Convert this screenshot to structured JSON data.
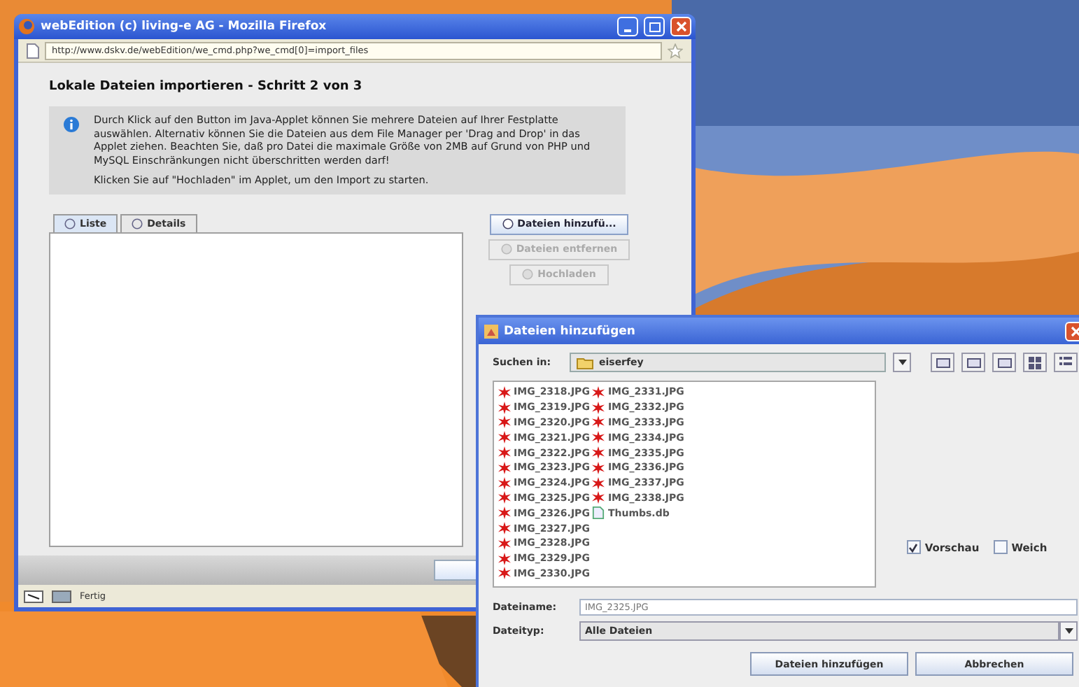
{
  "browser": {
    "title": "webEdition (c) living-e AG - Mozilla Firefox",
    "url": "http://www.dskv.de/webEdition/we_cmd.php?we_cmd[0]=import_files",
    "heading": "Lokale Dateien importieren - Schritt 2 von 3",
    "info": [
      "Durch Klick auf den Button im Java-Applet können Sie mehrere Dateien auf Ihrer Festplatte auswählen. Alternativ können Sie die Dateien aus dem File Manager per 'Drag and Drop' in das Applet ziehen. Beachten Sie, daß pro Datei die maximale Größe von 2MB auf Grund von PHP und MySQL Einschränkungen nicht überschritten werden darf!",
      "Klicken Sie auf \"Hochladen\" im Applet, um den Import zu starten."
    ],
    "tabs": [
      {
        "label": "Liste",
        "selected": true
      },
      {
        "label": "Details",
        "selected": false
      }
    ],
    "buttons": [
      {
        "label": "Dateien hinzufü...",
        "disabled": false
      },
      {
        "label": "Dateien entfernen",
        "disabled": true
      },
      {
        "label": "Hochladen",
        "disabled": true
      }
    ],
    "status": "Fertig"
  },
  "dialog": {
    "title": "Dateien hinzufügen",
    "look_in_label": "Suchen in:",
    "folder": "eiserfey",
    "files": [
      {
        "name": "IMG_2318.JPG"
      },
      {
        "name": "IMG_2319.JPG"
      },
      {
        "name": "IMG_2320.JPG"
      },
      {
        "name": "IMG_2321.JPG"
      },
      {
        "name": "IMG_2322.JPG"
      },
      {
        "name": "IMG_2323.JPG"
      },
      {
        "name": "IMG_2324.JPG"
      },
      {
        "name": "IMG_2325.JPG"
      },
      {
        "name": "IMG_2326.JPG"
      },
      {
        "name": "IMG_2327.JPG"
      },
      {
        "name": "IMG_2328.JPG"
      },
      {
        "name": "IMG_2329.JPG"
      },
      {
        "name": "IMG_2330.JPG"
      },
      {
        "name": "IMG_2331.JPG"
      },
      {
        "name": "IMG_2332.JPG"
      },
      {
        "name": "IMG_2333.JPG"
      },
      {
        "name": "IMG_2334.JPG"
      },
      {
        "name": "IMG_2335.JPG"
      },
      {
        "name": "IMG_2336.JPG"
      },
      {
        "name": "IMG_2337.JPG"
      },
      {
        "name": "IMG_2338.JPG"
      },
      {
        "name": "Thumbs.db",
        "kind": "database"
      }
    ],
    "options": [
      {
        "label": "Vorschau",
        "checked": true
      },
      {
        "label": "Weich",
        "checked": false
      }
    ],
    "filename_label": "Dateiname:",
    "filename": "IMG_2325.JPG",
    "filetype_label": "Dateityp:",
    "filetype": "Alle Dateien",
    "buttons": [
      "Dateien hinzufügen",
      "Abbrechen"
    ]
  }
}
